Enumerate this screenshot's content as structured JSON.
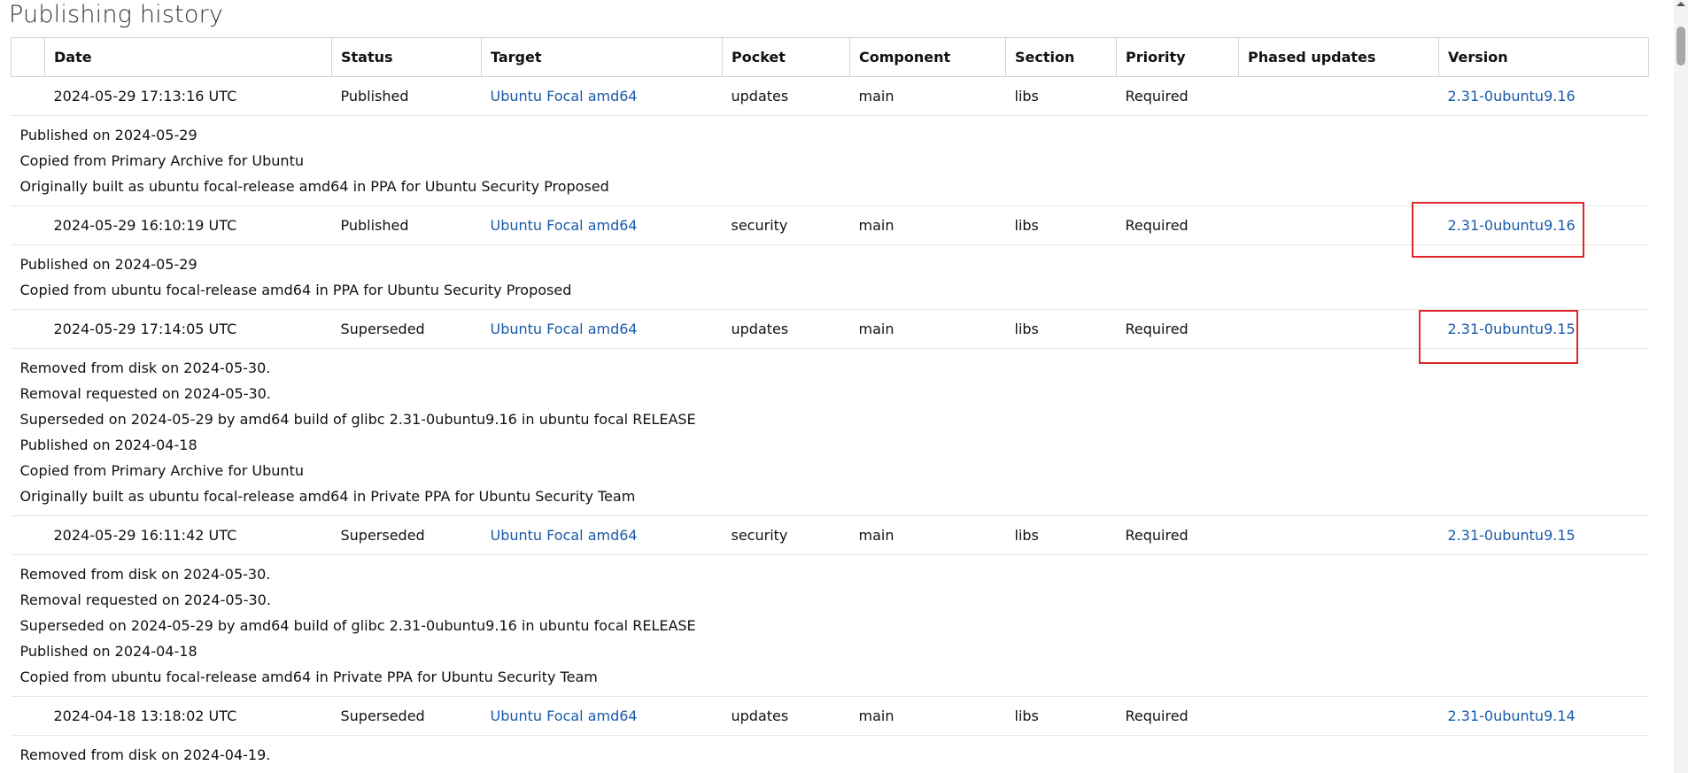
{
  "page": {
    "title": "Publishing history"
  },
  "table": {
    "columns": [
      "Date",
      "Status",
      "Target",
      "Pocket",
      "Component",
      "Section",
      "Priority",
      "Phased updates",
      "Version"
    ],
    "rows": [
      {
        "date": "2024-05-29 17:13:16 UTC",
        "status": "Published",
        "target": "Ubuntu Focal amd64",
        "pocket": "updates",
        "component": "main",
        "section": "libs",
        "priority": "Required",
        "phased": "",
        "version": "2.31-0ubuntu9.16",
        "details": [
          "Published on 2024-05-29",
          "Copied from Primary Archive for Ubuntu",
          "Originally built as ubuntu focal-release amd64 in PPA for Ubuntu Security Proposed"
        ]
      },
      {
        "date": "2024-05-29 16:10:19 UTC",
        "status": "Published",
        "target": "Ubuntu Focal amd64",
        "pocket": "security",
        "component": "main",
        "section": "libs",
        "priority": "Required",
        "phased": "",
        "version": "2.31-0ubuntu9.16",
        "details": [
          "Published on 2024-05-29",
          "Copied from ubuntu focal-release amd64 in PPA for Ubuntu Security Proposed"
        ]
      },
      {
        "date": "2024-05-29 17:14:05 UTC",
        "status": "Superseded",
        "target": "Ubuntu Focal amd64",
        "pocket": "updates",
        "component": "main",
        "section": "libs",
        "priority": "Required",
        "phased": "",
        "version": "2.31-0ubuntu9.15",
        "details": [
          "Removed from disk on 2024-05-30.",
          "Removal requested on 2024-05-30.",
          "Superseded on 2024-05-29 by amd64 build of glibc 2.31-0ubuntu9.16 in ubuntu focal RELEASE",
          "Published on 2024-04-18",
          "Copied from Primary Archive for Ubuntu",
          "Originally built as ubuntu focal-release amd64 in Private PPA for Ubuntu Security Team"
        ]
      },
      {
        "date": "2024-05-29 16:11:42 UTC",
        "status": "Superseded",
        "target": "Ubuntu Focal amd64",
        "pocket": "security",
        "component": "main",
        "section": "libs",
        "priority": "Required",
        "phased": "",
        "version": "2.31-0ubuntu9.15",
        "details": [
          "Removed from disk on 2024-05-30.",
          "Removal requested on 2024-05-30.",
          "Superseded on 2024-05-29 by amd64 build of glibc 2.31-0ubuntu9.16 in ubuntu focal RELEASE",
          "Published on 2024-04-18",
          "Copied from ubuntu focal-release amd64 in Private PPA for Ubuntu Security Team"
        ]
      },
      {
        "date": "2024-04-18 13:18:02 UTC",
        "status": "Superseded",
        "target": "Ubuntu Focal amd64",
        "pocket": "updates",
        "component": "main",
        "section": "libs",
        "priority": "Required",
        "phased": "",
        "version": "2.31-0ubuntu9.14",
        "details": [
          "Removed from disk on 2024-04-19."
        ]
      }
    ]
  },
  "colors": {
    "link": "#1a5aa8",
    "highlight": "#e0262b",
    "border": "#d4d4d4"
  }
}
